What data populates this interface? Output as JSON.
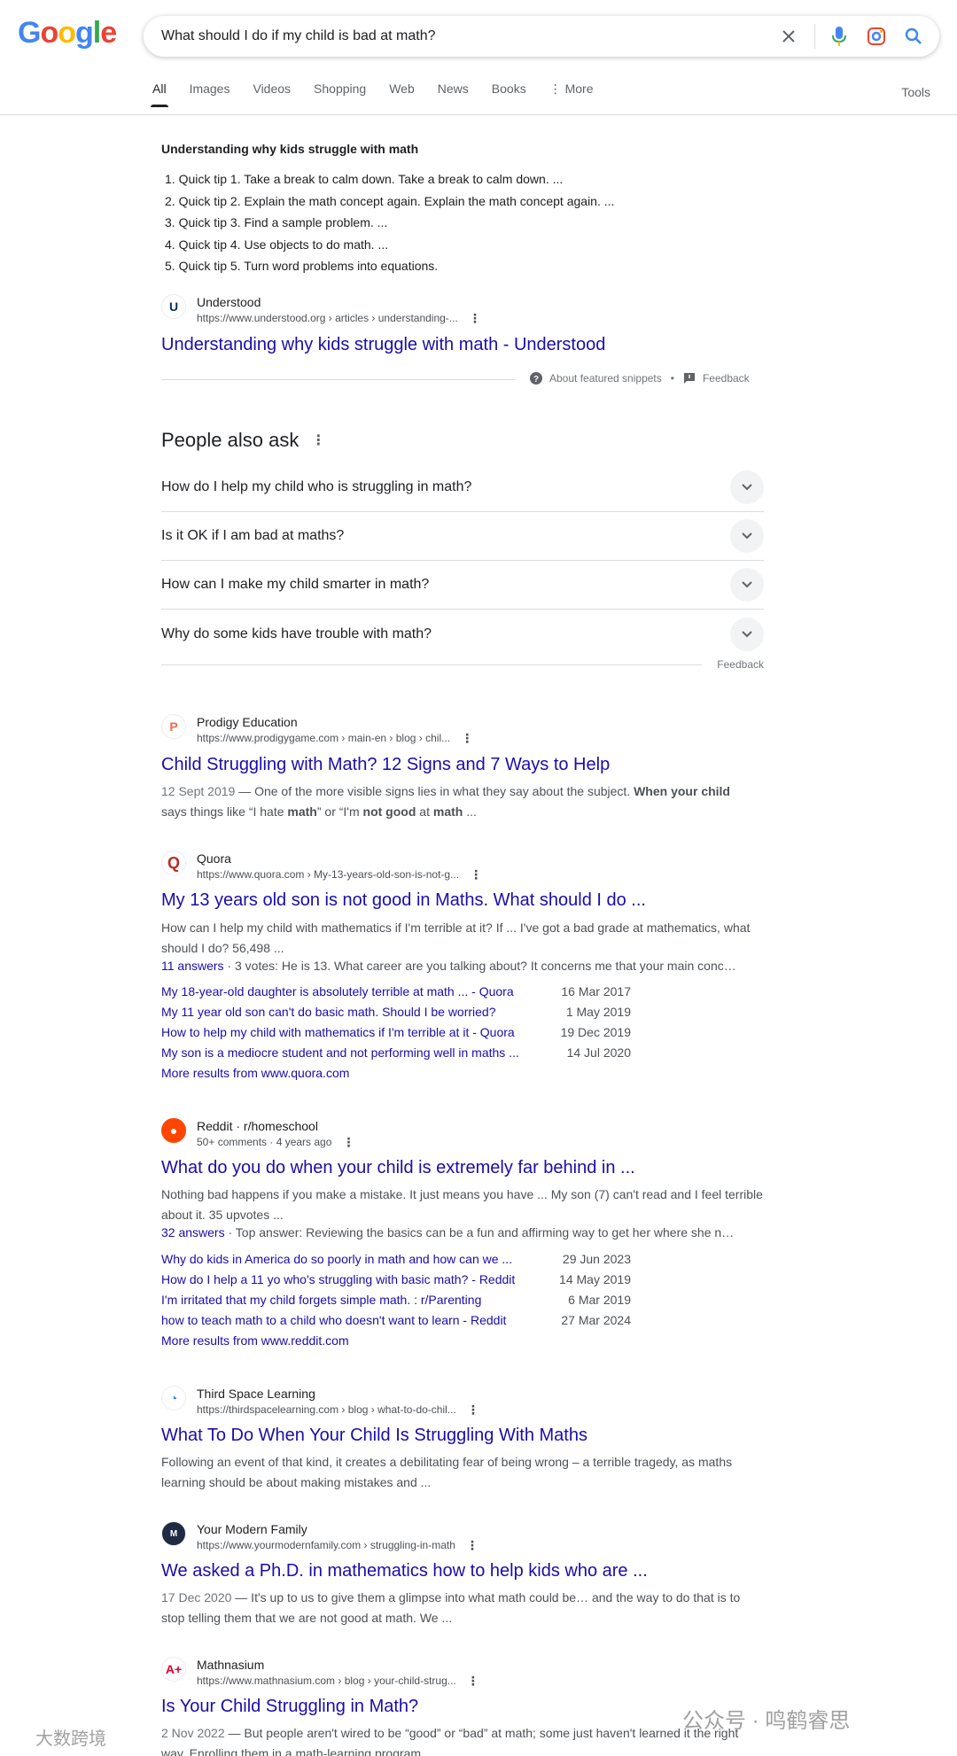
{
  "logo": {
    "letters": [
      "G",
      "o",
      "o",
      "g",
      "l",
      "e"
    ]
  },
  "search": {
    "query": "What should I do if my child is bad at math?"
  },
  "tabs": [
    {
      "label": "All",
      "active": true
    },
    {
      "label": "Images"
    },
    {
      "label": "Videos"
    },
    {
      "label": "Shopping"
    },
    {
      "label": "Web"
    },
    {
      "label": "News"
    },
    {
      "label": "Books"
    },
    {
      "label": "⋮ More"
    }
  ],
  "tools_label": "Tools",
  "featured": {
    "title": "Understanding why kids struggle with math",
    "items": [
      "1. Quick tip 1. Take a break to calm down. Take a break to calm down. ...",
      "2. Quick tip 2. Explain the math concept again. Explain the math concept again. ...",
      "3. Quick tip 3. Find a sample problem. ...",
      "4. Quick tip 4. Use objects to do math. ...",
      "5. Quick tip 5. Turn word problems into equations."
    ],
    "source_name": "Understood",
    "source_url": "https://www.understood.org › articles › understanding-...",
    "link_title": "Understanding why kids struggle with math - Understood",
    "about_label": "About featured snippets",
    "feedback_label": "Feedback"
  },
  "paa": {
    "title": "People also ask",
    "questions": [
      "How do I help my child who is struggling in math?",
      "Is it OK if I am bad at maths?",
      "How can I make my child smarter in math?",
      "Why do some kids have trouble with math?"
    ],
    "feedback_label": "Feedback"
  },
  "results": {
    "prodigy": {
      "name": "Prodigy Education",
      "url": "https://www.prodigygame.com › main-en › blog › chil...",
      "title": "Child Struggling with Math? 12 Signs and 7 Ways to Help",
      "date": "12 Sept 2019",
      "desc_1": " — One of the more visible signs lies in what they say about the subject. ",
      "desc_b1": "When your child",
      "desc_2": "says things like “I hate ",
      "desc_b2": "math",
      "desc_3": "” or “I'm ",
      "desc_b3": "not good",
      "desc_4": " at ",
      "desc_b4": "math",
      "desc_5": " ..."
    },
    "quora": {
      "name": "Quora",
      "url": "https://www.quora.com › My-13-years-old-son-is-not-g...",
      "title": "My 13 years old son is not good in Maths. What should I do ...",
      "desc": "How can I help my child with mathematics if I'm terrible at it? If ... I've got a bad grade at mathematics, what should I do? 56,498 ...",
      "answers_link": "11 answers",
      "answers_rest": " · 3 votes: He is 13. What career are you talking about? It concerns me that your main conc…",
      "sub": [
        {
          "title": "My 18-year-old daughter is absolutely terrible at math ... - Quora",
          "date": "16 Mar 2017"
        },
        {
          "title": "My 11 year old son can't do basic math. Should I be worried?",
          "date": "1 May 2019"
        },
        {
          "title": "How to help my child with mathematics if I'm terrible at it - Quora",
          "date": "19 Dec 2019"
        },
        {
          "title": "My son is a mediocre student and not performing well in maths ...",
          "date": "14 Jul 2020"
        }
      ],
      "more": "More results from www.quora.com"
    },
    "reddit": {
      "name": "Reddit · r/homeschool",
      "url": "50+ comments · 4 years ago",
      "title": "What do you do when your child is extremely far behind in ...",
      "desc": "Nothing bad happens if you make a mistake. It just means you have ... My son (7) can't read and I feel terrible about it. 35 upvotes ...",
      "answers_link": "32 answers",
      "answers_rest": " · Top answer: Reviewing the basics can be a fun and affirming way to get her where she n…",
      "sub": [
        {
          "title": "Why do kids in America do so poorly in math and how can we ...",
          "date": "29 Jun 2023"
        },
        {
          "title": "How do I help a 11 yo who's struggling with basic math? - Reddit",
          "date": "14 May 2019"
        },
        {
          "title": "I'm irritated that my child forgets simple math. : r/Parenting",
          "date": "6 Mar 2019"
        },
        {
          "title": "how to teach math to a child who doesn't want to learn - Reddit",
          "date": "27 Mar 2024"
        }
      ],
      "more": "More results from www.reddit.com"
    },
    "thirdspace": {
      "name": "Third Space Learning",
      "url": "https://thirdspacelearning.com › blog › what-to-do-chil...",
      "title": "What To Do When Your Child Is Struggling With Maths",
      "desc": "Following an event of that kind, it creates a debilitating fear of being wrong – a terrible tragedy, as maths learning should be about making mistakes and ..."
    },
    "ymf": {
      "name": "Your Modern Family",
      "url": "https://www.yourmodernfamily.com › struggling-in-math",
      "title": "We asked a Ph.D. in mathematics how to help kids who are ...",
      "date": "17 Dec 2020",
      "desc": " — It's up to us to give them a glimpse into what math could be… and the way to do that is to stop telling them that we are not good at math. We ..."
    },
    "mathnasium": {
      "name": "Mathnasium",
      "url": "https://www.mathnasium.com › blog › your-child-strug...",
      "title": "Is Your Child Struggling in Math?",
      "date": "2 Nov 2022",
      "desc": " — But people aren't wired to be “good” or “bad” at math; some just haven't learned it the right way. Enrolling them in a math-learning program ..."
    }
  },
  "watermarks": {
    "left": "大数跨境",
    "right": "公众号 · 鸣鹤睿思"
  },
  "colors": {
    "link": "#1a0dab",
    "text": "#202124",
    "gray": "#4d5156"
  }
}
